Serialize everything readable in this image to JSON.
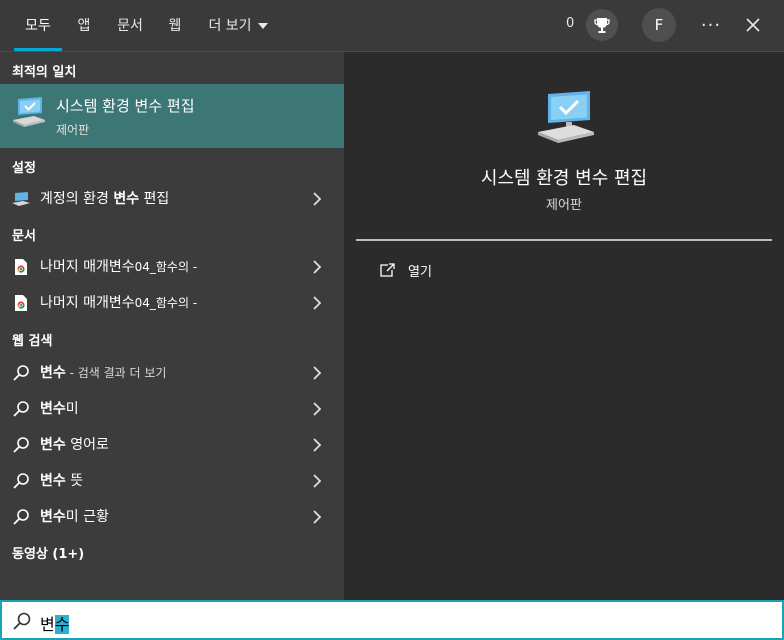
{
  "topbar": {
    "tabs": [
      {
        "label": "모두",
        "active": true
      },
      {
        "label": "앱"
      },
      {
        "label": "문서"
      },
      {
        "label": "웹"
      },
      {
        "label": "더 보기"
      }
    ],
    "points": "0",
    "avatar_initial": "F",
    "more_glyph": "···",
    "icons": [
      "trophy-icon",
      "close-icon",
      "chevron-down-icon"
    ]
  },
  "left": {
    "best_match_header": "최적의 일치",
    "best_match": {
      "title": "시스템 환경 변수 편집",
      "subtitle": "제어판",
      "icon": "system-pc-icon"
    },
    "settings_header": "설정",
    "settings_item": {
      "pre": "계정의 환경 ",
      "bold": "변수",
      "post": " 편집",
      "icon": "settings-pc-icon"
    },
    "documents_header": "문서",
    "documents": [
      {
        "pre": "나머지 매개변수",
        "small": "04_함수의 -",
        "icon": "chrome-doc-icon"
      },
      {
        "pre": "나머지 매개변수",
        "small": "04_함수의 -",
        "icon": "chrome-doc-icon"
      }
    ],
    "web_header": "웹 검색",
    "web": [
      {
        "bold": "변수",
        "rest": "",
        "suffix": " - 검색 결과 더 보기"
      },
      {
        "bold": "변수",
        "rest": "미",
        "suffix": ""
      },
      {
        "bold": "변수",
        "rest": " 영어로",
        "suffix": ""
      },
      {
        "bold": "변수",
        "rest": " 뜻",
        "suffix": ""
      },
      {
        "bold": "변수",
        "rest": "미 근황",
        "suffix": ""
      }
    ],
    "video_header": "동영상 (1+)"
  },
  "right": {
    "title": "시스템 환경 변수 편집",
    "subtitle": "제어판",
    "open_label": "열기",
    "icon": "system-pc-icon"
  },
  "search": {
    "typed": "변",
    "selected": "수",
    "icon": "search-icon"
  },
  "colors": {
    "accent": "#00a9d6",
    "best_match_bg": "#3d7775",
    "search_border": "#1aa3b3",
    "selection": "#29b1d1"
  }
}
